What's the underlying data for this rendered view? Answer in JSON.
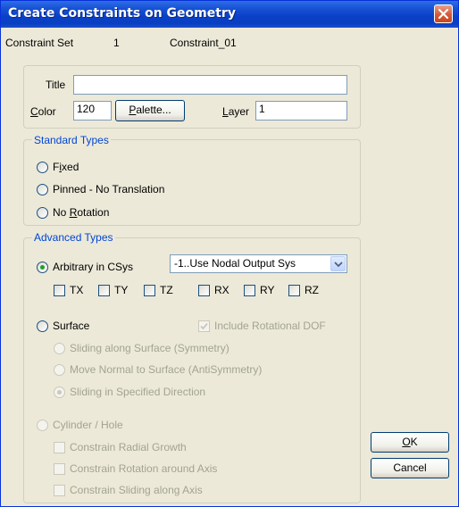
{
  "window": {
    "title": "Create Constraints on Geometry"
  },
  "constraint_set": {
    "label": "Constraint Set",
    "number": "1",
    "name": "Constraint_01"
  },
  "general": {
    "title_label": "Title",
    "title_value": "",
    "color_label": "Color",
    "color_value": "120",
    "palette_button": "Palette...",
    "layer_label": "Layer",
    "layer_value": "1"
  },
  "standard_types": {
    "legend": "Standard Types",
    "options": [
      "Fixed",
      "Pinned - No Translation",
      "No Rotation"
    ]
  },
  "advanced_types": {
    "legend": "Advanced Types",
    "arbitrary_label": "Arbitrary in CSys",
    "csys_selected": "-1..Use Nodal Output Sys",
    "dofs": [
      "TX",
      "TY",
      "TZ",
      "RX",
      "RY",
      "RZ"
    ],
    "surface_label": "Surface",
    "include_rotational": "Include Rotational DOF",
    "surface_options": [
      "Sliding along Surface (Symmetry)",
      "Move Normal to Surface (AntiSymmetry)",
      "Sliding in Specified Direction"
    ],
    "cylinder_label": "Cylinder / Hole",
    "cylinder_options": [
      "Constrain Radial Growth",
      "Constrain Rotation around Axis",
      "Constrain Sliding along Axis"
    ]
  },
  "buttons": {
    "ok": "OK",
    "cancel": "Cancel"
  },
  "colors": {
    "title_bar": "#0a3fc8",
    "dialog_face": "#ece9d8",
    "legend_text": "#0046d5",
    "radio_selected": "#21a121",
    "disabled_text": "#a3a391"
  }
}
